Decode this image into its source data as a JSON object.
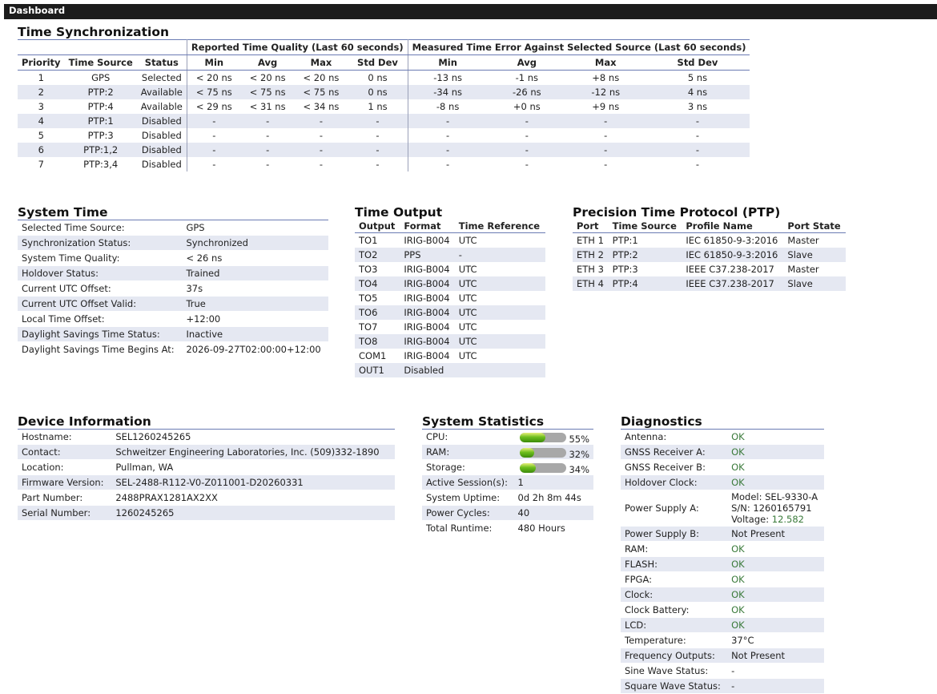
{
  "header": {
    "title": "Dashboard"
  },
  "time_sync": {
    "title": "Time Synchronization",
    "group1": "Reported Time Quality (Last 60 seconds)",
    "group2": "Measured Time Error Against Selected Source (Last 60 seconds)",
    "columns": [
      "Priority",
      "Time Source",
      "Status",
      "Min",
      "Avg",
      "Max",
      "Std Dev",
      "Min",
      "Avg",
      "Max",
      "Std Dev"
    ],
    "rows": [
      [
        "1",
        "GPS",
        "Selected",
        "< 20 ns",
        "< 20 ns",
        "< 20 ns",
        "0 ns",
        "-13 ns",
        "-1 ns",
        "+8 ns",
        "5 ns"
      ],
      [
        "2",
        "PTP:2",
        "Available",
        "< 75 ns",
        "< 75 ns",
        "< 75 ns",
        "0 ns",
        "-34 ns",
        "-26 ns",
        "-12 ns",
        "4 ns"
      ],
      [
        "3",
        "PTP:4",
        "Available",
        "< 29 ns",
        "< 31 ns",
        "< 34 ns",
        "1 ns",
        "-8 ns",
        "+0 ns",
        "+9 ns",
        "3 ns"
      ],
      [
        "4",
        "PTP:1",
        "Disabled",
        "-",
        "-",
        "-",
        "-",
        "-",
        "-",
        "-",
        "-"
      ],
      [
        "5",
        "PTP:3",
        "Disabled",
        "-",
        "-",
        "-",
        "-",
        "-",
        "-",
        "-",
        "-"
      ],
      [
        "6",
        "PTP:1,2",
        "Disabled",
        "-",
        "-",
        "-",
        "-",
        "-",
        "-",
        "-",
        "-"
      ],
      [
        "7",
        "PTP:3,4",
        "Disabled",
        "-",
        "-",
        "-",
        "-",
        "-",
        "-",
        "-",
        "-"
      ]
    ]
  },
  "system_time": {
    "title": "System Time",
    "rows": [
      [
        "Selected Time Source:",
        "GPS"
      ],
      [
        "Synchronization Status:",
        "Synchronized"
      ],
      [
        "System Time Quality:",
        "< 26 ns"
      ],
      [
        "Holdover Status:",
        "Trained"
      ],
      [
        "Current UTC Offset:",
        "37s"
      ],
      [
        "Current UTC Offset Valid:",
        "True"
      ],
      [
        "Local Time Offset:",
        "+12:00"
      ],
      [
        "Daylight Savings Time Status:",
        "Inactive"
      ],
      [
        "Daylight Savings Time Begins At:",
        "2026-09-27T02:00:00+12:00"
      ]
    ]
  },
  "time_output": {
    "title": "Time Output",
    "columns": [
      "Output",
      "Format",
      "Time Reference"
    ],
    "rows": [
      [
        "TO1",
        "IRIG-B004",
        "UTC"
      ],
      [
        "TO2",
        "PPS",
        "-"
      ],
      [
        "TO3",
        "IRIG-B004",
        "UTC"
      ],
      [
        "TO4",
        "IRIG-B004",
        "UTC"
      ],
      [
        "TO5",
        "IRIG-B004",
        "UTC"
      ],
      [
        "TO6",
        "IRIG-B004",
        "UTC"
      ],
      [
        "TO7",
        "IRIG-B004",
        "UTC"
      ],
      [
        "TO8",
        "IRIG-B004",
        "UTC"
      ],
      [
        "COM1",
        "IRIG-B004",
        "UTC"
      ],
      [
        "OUT1",
        "Disabled",
        ""
      ]
    ]
  },
  "ptp": {
    "title": "Precision Time Protocol (PTP)",
    "columns": [
      "Port",
      "Time Source",
      "Profile Name",
      "Port State"
    ],
    "rows": [
      [
        "ETH 1",
        "PTP:1",
        "IEC 61850-9-3:2016",
        "Master"
      ],
      [
        "ETH 2",
        "PTP:2",
        "IEC 61850-9-3:2016",
        "Slave"
      ],
      [
        "ETH 3",
        "PTP:3",
        "IEEE C37.238-2017",
        "Master"
      ],
      [
        "ETH 4",
        "PTP:4",
        "IEEE C37.238-2017",
        "Slave"
      ]
    ]
  },
  "device_info": {
    "title": "Device Information",
    "rows": [
      [
        "Hostname:",
        "SEL1260245265"
      ],
      [
        "Contact:",
        "Schweitzer Engineering Laboratories, Inc. (509)332-1890"
      ],
      [
        "Location:",
        "Pullman, WA"
      ],
      [
        "Firmware Version:",
        "SEL-2488-R112-V0-Z011001-D20260331"
      ],
      [
        "Part Number:",
        "2488PRAX1281AX2XX"
      ],
      [
        "Serial Number:",
        "1260245265"
      ]
    ]
  },
  "system_stats": {
    "title": "System Statistics",
    "usage": [
      {
        "label": "CPU:",
        "value": "55%",
        "fraction": 0.55
      },
      {
        "label": "RAM:",
        "value": "32%",
        "fraction": 0.32
      },
      {
        "label": "Storage:",
        "value": "34%",
        "fraction": 0.34
      }
    ],
    "rows": [
      [
        "Active Session(s):",
        "1"
      ],
      [
        "System Uptime:",
        "0d 2h 8m 44s"
      ],
      [
        "Power Cycles:",
        "40"
      ],
      [
        "Total Runtime:",
        "480 Hours"
      ]
    ]
  },
  "diagnostics": {
    "title": "Diagnostics",
    "rows": [
      {
        "label": "Antenna:",
        "value": "OK",
        "ok": true
      },
      {
        "label": "GNSS Receiver A:",
        "value": "OK",
        "ok": true
      },
      {
        "label": "GNSS Receiver B:",
        "value": "OK",
        "ok": true
      },
      {
        "label": "Holdover Clock:",
        "value": "OK",
        "ok": true
      },
      {
        "label": "Power Supply A:",
        "model": "Model: SEL-9330-A",
        "sn": "S/N: 1260165791",
        "voltage_label": "Voltage:",
        "voltage": "12.582"
      },
      {
        "label": "Power Supply B:",
        "value": "Not Present",
        "ok": false
      },
      {
        "label": "RAM:",
        "value": "OK",
        "ok": true
      },
      {
        "label": "FLASH:",
        "value": "OK",
        "ok": true
      },
      {
        "label": "FPGA:",
        "value": "OK",
        "ok": true
      },
      {
        "label": "Clock:",
        "value": "OK",
        "ok": true
      },
      {
        "label": "Clock Battery:",
        "value": "OK",
        "ok": true
      },
      {
        "label": "LCD:",
        "value": "OK",
        "ok": true
      },
      {
        "label": "Temperature:",
        "value": "37°C",
        "ok": false
      },
      {
        "label": "Frequency Outputs:",
        "value": "Not Present",
        "ok": false
      },
      {
        "label": "Sine Wave Status:",
        "value": "-",
        "ok": false
      },
      {
        "label": "Square Wave Status:",
        "value": "-",
        "ok": false
      }
    ]
  },
  "colors": {
    "header_bg": "#1c1c1c",
    "row_alt": "#e5e8f2",
    "rule": "#6b7bb3",
    "ok": "#3a7a3a"
  }
}
